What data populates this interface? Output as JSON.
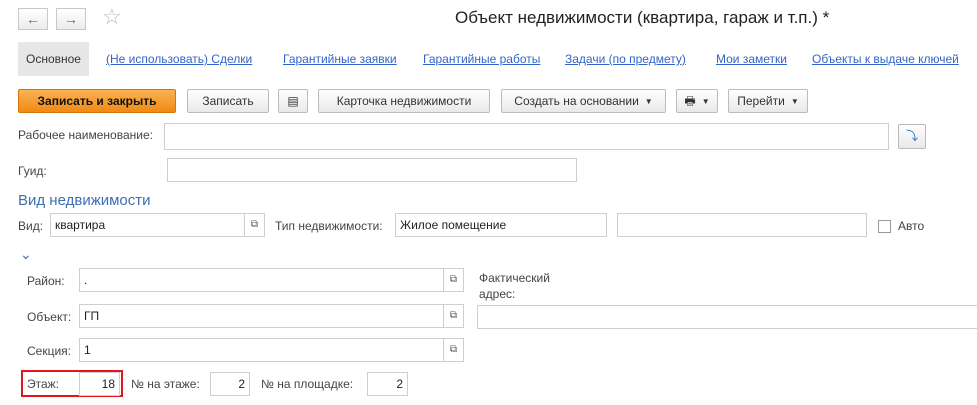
{
  "window": {
    "title": "Объект недвижимости (квартира, гараж и т.п.) *"
  },
  "tabs": [
    {
      "label": "Основное"
    },
    {
      "label": "(Не использовать) Сделки"
    },
    {
      "label": "Гарантийные заявки"
    },
    {
      "label": "Гарантийные работы"
    },
    {
      "label": "Задачи (по предмету)"
    },
    {
      "label": "Мои заметки"
    },
    {
      "label": "Объекты к выдаче ключей"
    }
  ],
  "toolbar": {
    "save_close": "Записать и закрыть",
    "save": "Записать",
    "property_card": "Карточка недвижимости",
    "create_based_on": "Создать на основании",
    "go_to": "Перейти"
  },
  "form": {
    "work_name_label": "Рабочее наименование:",
    "work_name_value": "",
    "guid_label": "Гуид:",
    "guid_value": "",
    "section_title": "Вид недвижимости",
    "kind_label": "Вид:",
    "kind_value": "квартира",
    "type_label": "Тип недвижимости:",
    "type_value": "Жилое помещение",
    "extra_value": "",
    "auto_label": "Авто",
    "auto_checked": false,
    "district_label": "Район:",
    "district_value": ".",
    "actual_address_label": "Фактический адрес:",
    "actual_address_value": "",
    "object_label": "Объект:",
    "object_value": "ГП",
    "section_label": "Секция:",
    "section_value": "1",
    "floor_label": "Этаж:",
    "floor_value": "18",
    "floor_number_label": "№ на этаже:",
    "floor_number_value": "2",
    "site_number_label": "№ на площадке:",
    "site_number_value": "2"
  },
  "colors": {
    "accent": "#f08a12",
    "link": "#3164c9",
    "section": "#3d6fb6",
    "highlight": "#e3141b"
  }
}
